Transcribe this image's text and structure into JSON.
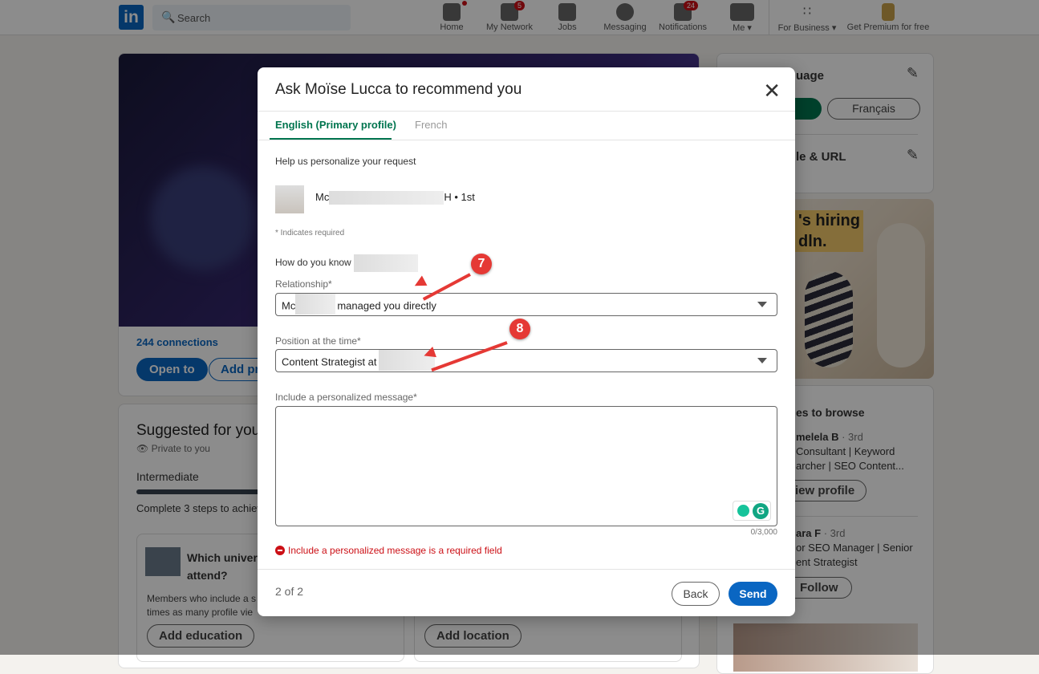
{
  "topbar": {
    "search_placeholder": "Search",
    "nav": [
      {
        "label": "Home",
        "badge": ""
      },
      {
        "label": "My Network",
        "badge": "5"
      },
      {
        "label": "Jobs",
        "badge": ""
      },
      {
        "label": "Messaging",
        "badge": ""
      },
      {
        "label": "Notifications",
        "badge": "24"
      },
      {
        "label": "Me ▾",
        "badge": ""
      },
      {
        "label": "For Business ▾",
        "badge": ""
      },
      {
        "label": "Get Premium for free",
        "badge": ""
      }
    ]
  },
  "background": {
    "connections": "244 connections",
    "open_to": "Open to",
    "add_profile": "Add pr",
    "suggested_title": "Suggested for you",
    "private": "Private to you",
    "level": "Intermediate",
    "complete": "Complete 3 steps to achiev",
    "univ_q1": "Which univers",
    "univ_q2": "attend?",
    "members_text1": "Members who include a s",
    "members_text2": "times as many profile vie",
    "add_education": "Add education",
    "add_location": "Add location",
    "lang_title": "uage",
    "lang_fr": "Français",
    "url_title": "le & URL",
    "ad_line1": "'s hiring",
    "ad_line2": "dln.",
    "browse_title": "es to browse",
    "p1_name": "melela B",
    "p1_deg": "· 3rd",
    "p1_h1": "Consultant | Keyword",
    "p1_h2": "archer | SEO Content...",
    "view_profile": "iew profile",
    "p2_name": "ara F",
    "p2_deg": "· 3rd",
    "p2_h1": "or SEO Manager | Senior",
    "p2_h2": "ent Strategist",
    "follow": "Follow"
  },
  "modal": {
    "title": "Ask Moïse Lucca to recommend you",
    "tabs": [
      "English (Primary profile)",
      "French"
    ],
    "help": "Help us personalize your request",
    "person_prefix": "Mc",
    "person_suffix": "H • 1st",
    "required_note": "* Indicates required",
    "how_know": "How do you know",
    "relationship_label": "Relationship*",
    "relationship_prefix": "Mc",
    "relationship_value": "managed you directly",
    "position_label": "Position at the time*",
    "position_value": "Content Strategist at",
    "message_label": "Include a personalized message*",
    "message_value": "",
    "char_count": "0/3,000",
    "error": "Include a personalized message is a required field",
    "step": "2 of 2",
    "back": "Back",
    "send": "Send"
  },
  "annotations": [
    "7",
    "8"
  ],
  "colors": {
    "accent": "#0a66c2",
    "tab_active": "#01754f",
    "error": "#cc1016",
    "annotation": "#e53935"
  }
}
